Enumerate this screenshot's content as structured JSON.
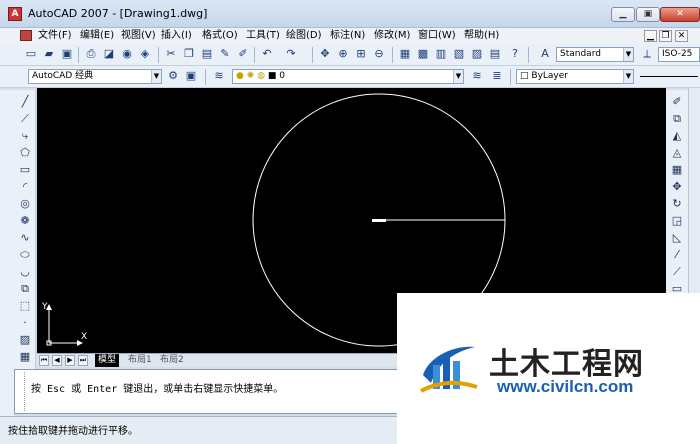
{
  "window": {
    "title": "AutoCAD 2007 - [Drawing1.dwg]",
    "app_icon": "autocad-logo-icon",
    "controls": [
      "minimize-icon",
      "maximize-icon",
      "close-icon"
    ]
  },
  "menu": {
    "items": [
      "文件(F)",
      "编辑(E)",
      "视图(V)",
      "插入(I)",
      "格式(O)",
      "工具(T)",
      "绘图(D)",
      "标注(N)",
      "修改(M)",
      "窗口(W)",
      "帮助(H)"
    ]
  },
  "toolbar_top": {
    "text_style": "Standard",
    "dim_style": "ISO-25"
  },
  "toolbar_second": {
    "workspace": "AutoCAD 经典",
    "layer": "0",
    "color": "ByLayer"
  },
  "drawing": {
    "circle": {
      "center": [
        342,
        132
      ],
      "radius": 126
    },
    "radius_line": {
      "from": [
        342,
        132
      ],
      "to": [
        468,
        132
      ]
    },
    "cursor_marker": {
      "at": [
        342,
        132
      ]
    },
    "ucs": {
      "x_label": "X",
      "y_label": "Y"
    }
  },
  "layout_tabs": [
    "模型",
    "布局1",
    "布局2"
  ],
  "command_line": {
    "prompt": "按 Esc 或 Enter 键退出，或单击右键显示快捷菜单。"
  },
  "status": {
    "text": "按住拾取键并拖动进行平移。"
  },
  "watermark": {
    "name": "土木工程网",
    "url": "www.civilcn.com"
  },
  "colors": {
    "canvas": "#000000",
    "geometry": "#ffffff",
    "watermark_blue": "#1a5fb4"
  }
}
